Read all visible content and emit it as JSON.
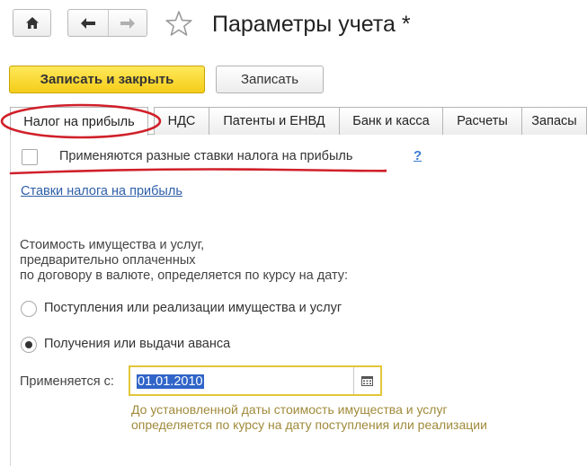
{
  "header": {
    "title": "Параметры учета *",
    "icons": {
      "home": "home-icon",
      "back": "arrow-left-icon",
      "forward": "arrow-right-icon",
      "favorite": "star-icon"
    }
  },
  "toolbar": {
    "save_close_label": "Записать и закрыть",
    "save_label": "Записать"
  },
  "tabs": [
    {
      "label": "Налог на прибыль",
      "active": true
    },
    {
      "label": "НДС",
      "active": false
    },
    {
      "label": "Патенты и ЕНВД",
      "active": false
    },
    {
      "label": "Банк и касса",
      "active": false
    },
    {
      "label": "Расчеты",
      "active": false
    },
    {
      "label": "Запасы",
      "active": false
    }
  ],
  "profit_tax": {
    "different_rates_label": "Применяются разные ставки налога на прибыль",
    "different_rates_checked": false,
    "help_label": "?",
    "rates_link": "Ставки налога на прибыль",
    "description_lines": [
      "Стоимость имущества и услуг,",
      "предварительно оплаченных",
      "по договору в валюте, определяется по курсу на дату:"
    ],
    "options": [
      {
        "label": "Поступления или реализации имущества и услуг",
        "selected": false
      },
      {
        "label": "Получения или выдачи аванса",
        "selected": true
      }
    ],
    "applies_from_label": "Применяется с:",
    "applies_from_value": "01.01.2010",
    "hint_lines": [
      "До установленной даты стоимость имущества и услуг",
      "определяется по курсу на дату поступления или реализации"
    ]
  },
  "colors": {
    "primary_button": "#f5cd19",
    "link": "#2f5fa8",
    "hint": "#a08a3a",
    "annotation": "#d0202a",
    "selection": "#3064c8"
  }
}
